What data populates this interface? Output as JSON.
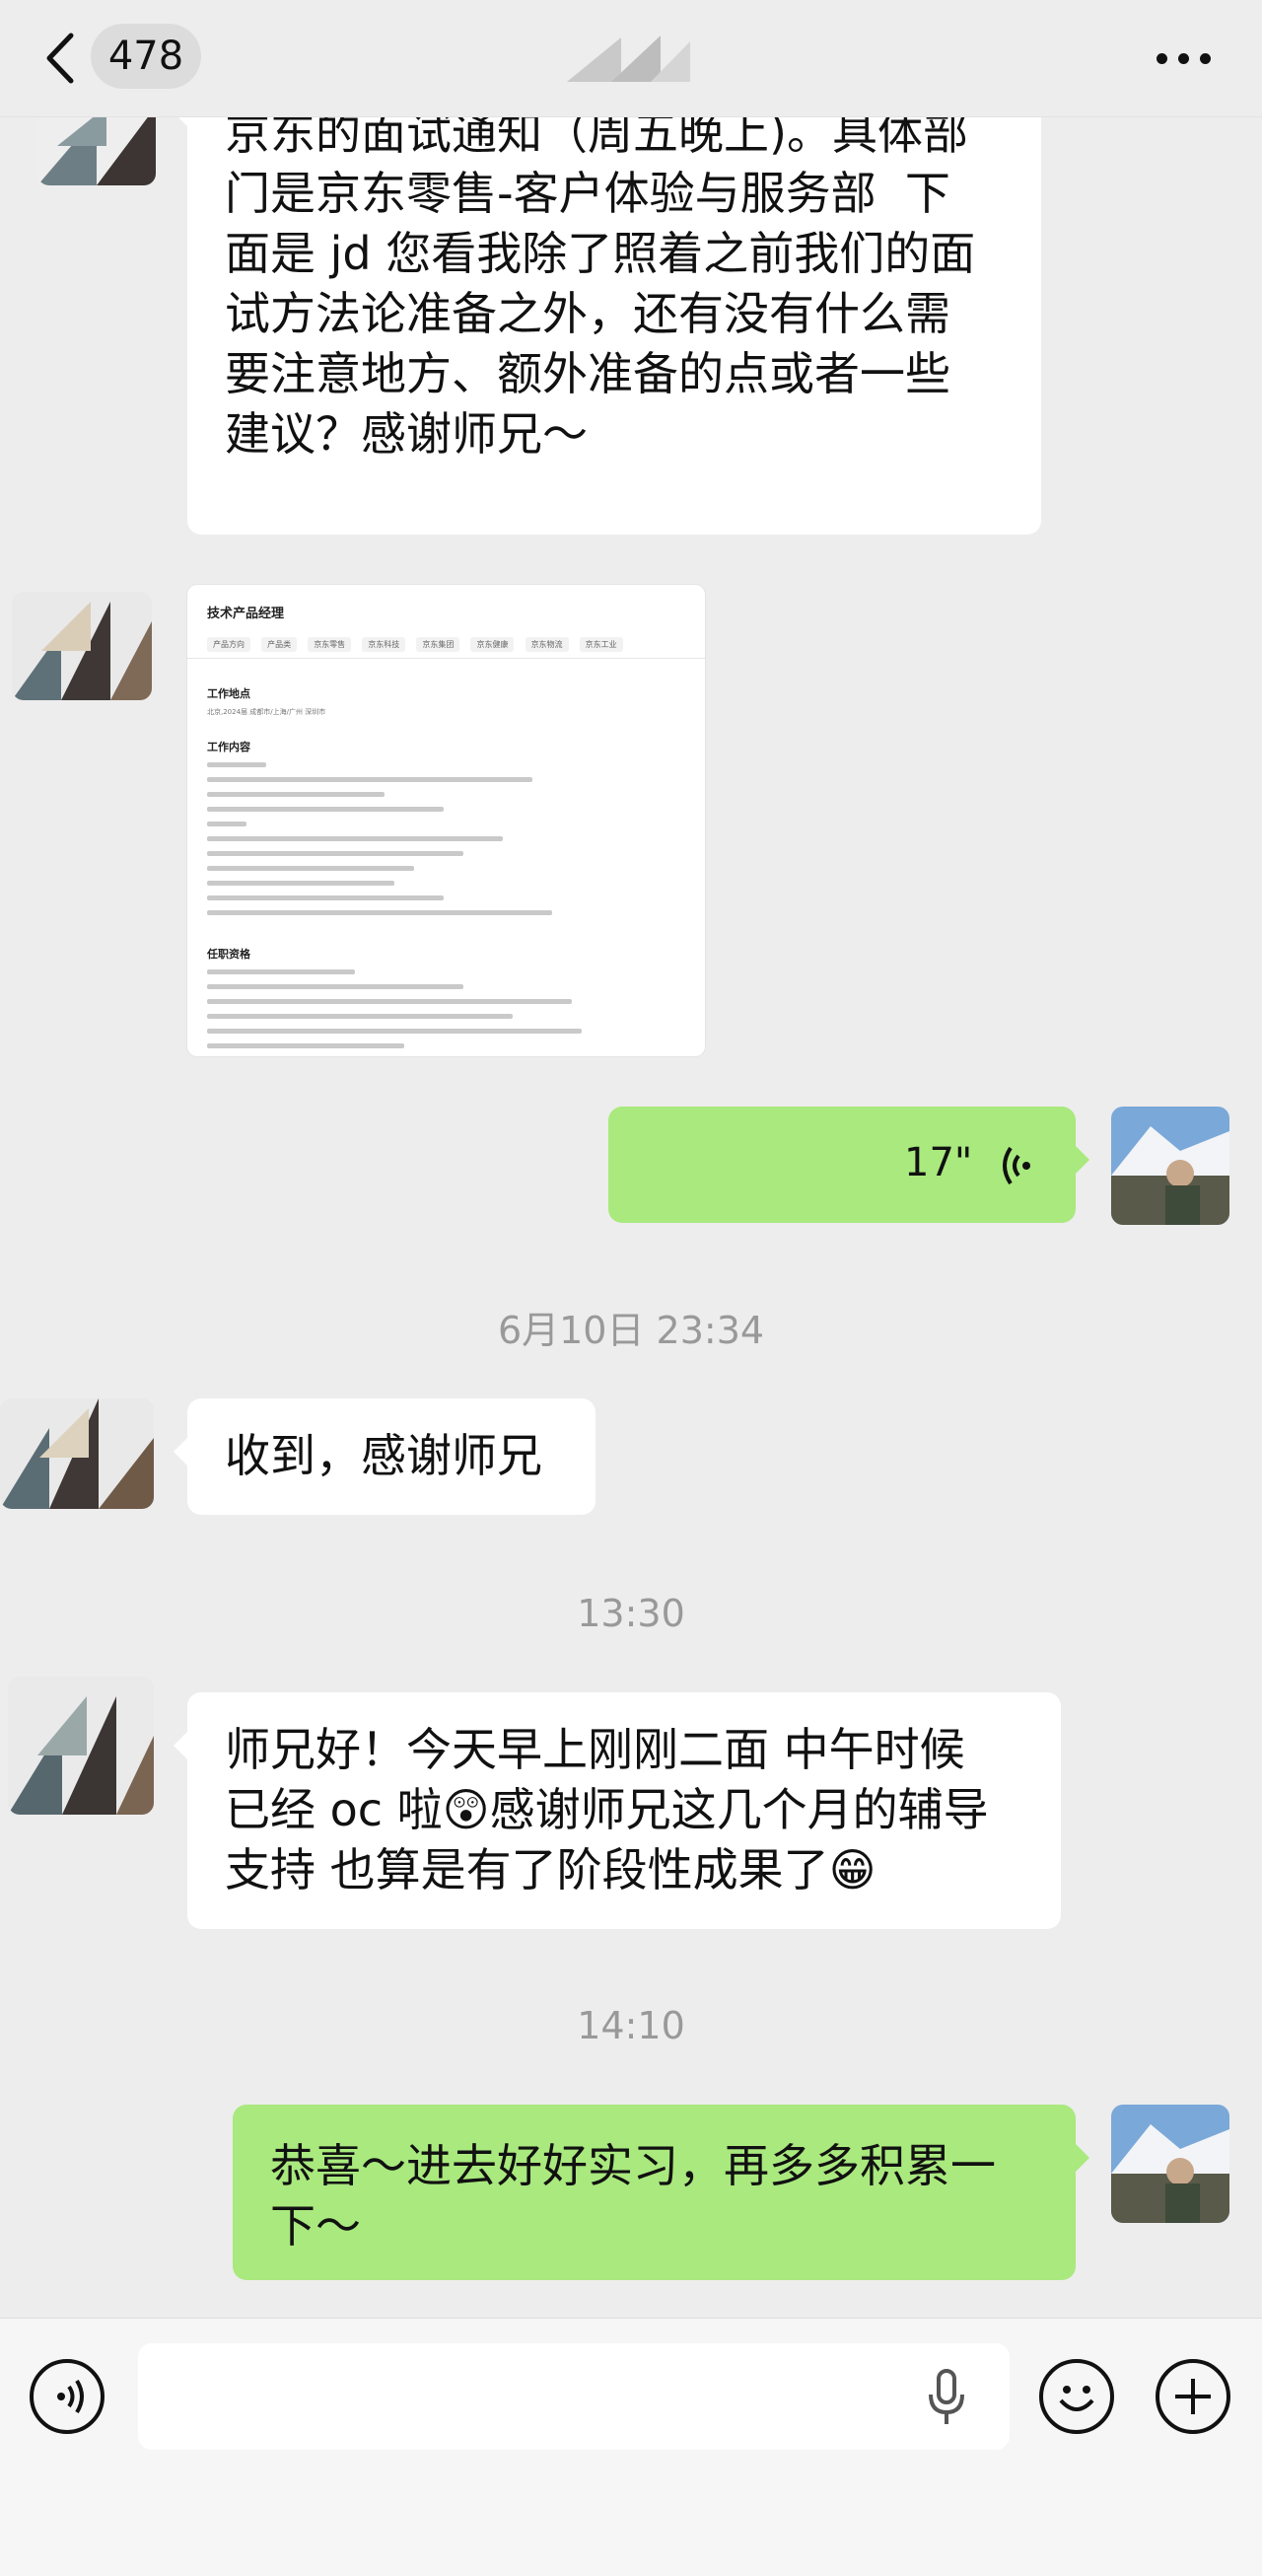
{
  "header": {
    "unread_count": "478",
    "icons": {
      "back": "chevron-left-icon",
      "more": "more-dots-icon"
    }
  },
  "messages": [
    {
      "id": "m1",
      "side": "left",
      "text": "师兄好，抱歉打扰了。我刚刚接到了\n京东的面试通知（周五晚上)。具体部\n门是京东零售-客户体验与服务部  下\n面是 jd 您看我除了照着之前我们的面\n试方法论准备之外，还有没有什么需\n要注意地方、额外准备的点或者一些\n建议？感谢师兄～"
    },
    {
      "id": "m2",
      "side": "left",
      "type": "image"
    },
    {
      "id": "m3",
      "side": "right",
      "type": "voice",
      "duration": "17\""
    },
    {
      "id": "m4",
      "side": "left",
      "text": "收到，感谢师兄"
    },
    {
      "id": "m5",
      "side": "left",
      "text": "师兄好！今天早上刚刚二面 中午时候\n已经 oc 啦😲感谢师兄这几个月的辅导\n支持 也算是有了阶段性成果了😁"
    },
    {
      "id": "m6",
      "side": "right",
      "text": "恭喜～进去好好实习，再多多积累一\n下～"
    }
  ],
  "timestamps": [
    "6月10日 23:34",
    "13:30",
    "14:10"
  ],
  "jd_image": {
    "title": "技术产品经理",
    "tags": [
      "产品方向",
      "产品类",
      "京东零售",
      "京东科技",
      "京东集团",
      "京东健康",
      "京东物流",
      "京东工业"
    ],
    "section_location": "工作地点",
    "location_text": "北京,2024届 成都市/上海/广州 深圳市",
    "section_content": "工作内容",
    "section_requirements": "任职资格"
  },
  "colors": {
    "background": "#ededed",
    "bubble_left": "#ffffff",
    "bubble_right": "#a9e97e",
    "timestamp": "#999999"
  },
  "bottom": {
    "icons": [
      "voice-mode-icon",
      "microphone-icon",
      "emoji-icon",
      "plus-icon"
    ]
  }
}
